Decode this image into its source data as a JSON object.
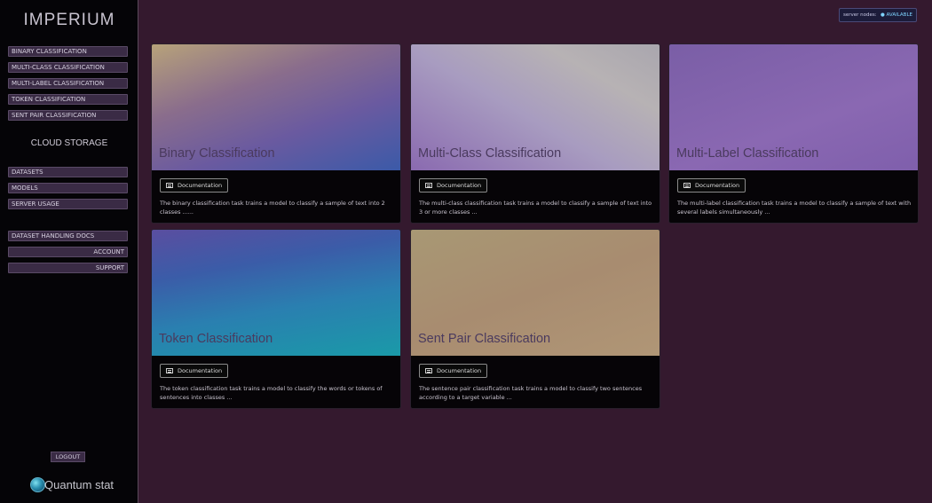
{
  "sidebar": {
    "brand": "IMPERIUM",
    "task_nav": [
      {
        "label": "BINARY CLASSIFICATION"
      },
      {
        "label": "MULTI-CLASS CLASSIFICATION"
      },
      {
        "label": "MULTI-LABEL CLASSIFICATION"
      },
      {
        "label": "TOKEN CLASSIFICATION"
      },
      {
        "label": "SENT PAIR CLASSIFICATION"
      }
    ],
    "cloud_storage_heading": "CLOUD STORAGE",
    "storage_nav": [
      {
        "label": "DATASETS"
      },
      {
        "label": "MODELS"
      },
      {
        "label": "SERVER USAGE"
      }
    ],
    "dataset_docs_label": "DATASET HANDLING DOCS",
    "account_label": "ACCOUNT",
    "support_label": "SUPPORT",
    "logout_label": "LOGOUT",
    "logo_text": "Quantum stat"
  },
  "status": {
    "label": "server nodes:",
    "value": "● AVAILABLE"
  },
  "cards": [
    {
      "title": "Binary Classification",
      "doc_label": "Documentation",
      "description": "The binary classification task trains a model to classify a sample of text into 2 classes ......"
    },
    {
      "title": "Multi-Class Classification",
      "doc_label": "Documentation",
      "description": "The multi-class classification task trains a model to classify a sample of text into 3 or more classes ..."
    },
    {
      "title": "Multi-Label Classification",
      "doc_label": "Documentation",
      "description": "The multi-label classification task trains a model to classify a sample of text with several labels simultaneously ..."
    },
    {
      "title": "Token Classification",
      "doc_label": "Documentation",
      "description": "The token classification task trains a model to classify the words or tokens of sentences into classes ..."
    },
    {
      "title": "Sent Pair Classification",
      "doc_label": "Documentation",
      "description": "The sentence pair classification task trains a model to classify two sentences according to a target variable ..."
    }
  ]
}
